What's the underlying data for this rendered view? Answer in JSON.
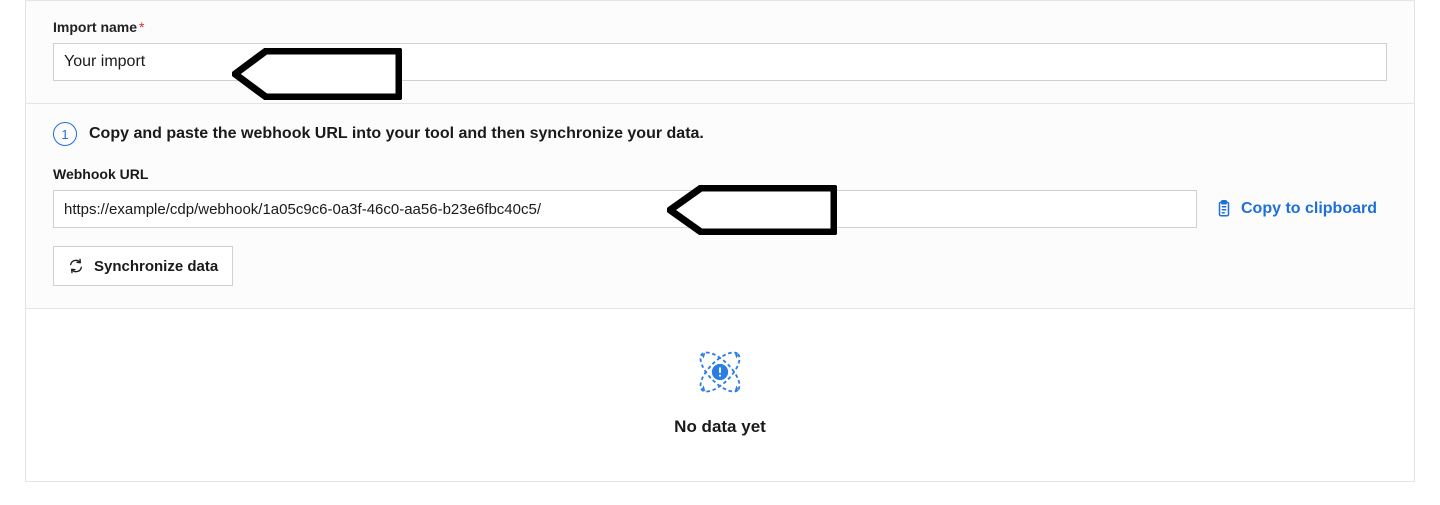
{
  "form": {
    "import_name_label": "Import name",
    "import_name_value": "Your import"
  },
  "step": {
    "number": "1",
    "text": "Copy and paste the webhook URL into your tool and then synchronize your data."
  },
  "webhook": {
    "label": "Webhook URL",
    "value": "https://example/cdp/webhook/1a05c9c6-0a3f-46c0-aa56-b23e6fbc40c5/",
    "copy_label": "Copy to clipboard"
  },
  "sync_button_label": "Synchronize data",
  "empty_state": {
    "text": "No data yet"
  },
  "colors": {
    "accent": "#1e6fd9"
  }
}
